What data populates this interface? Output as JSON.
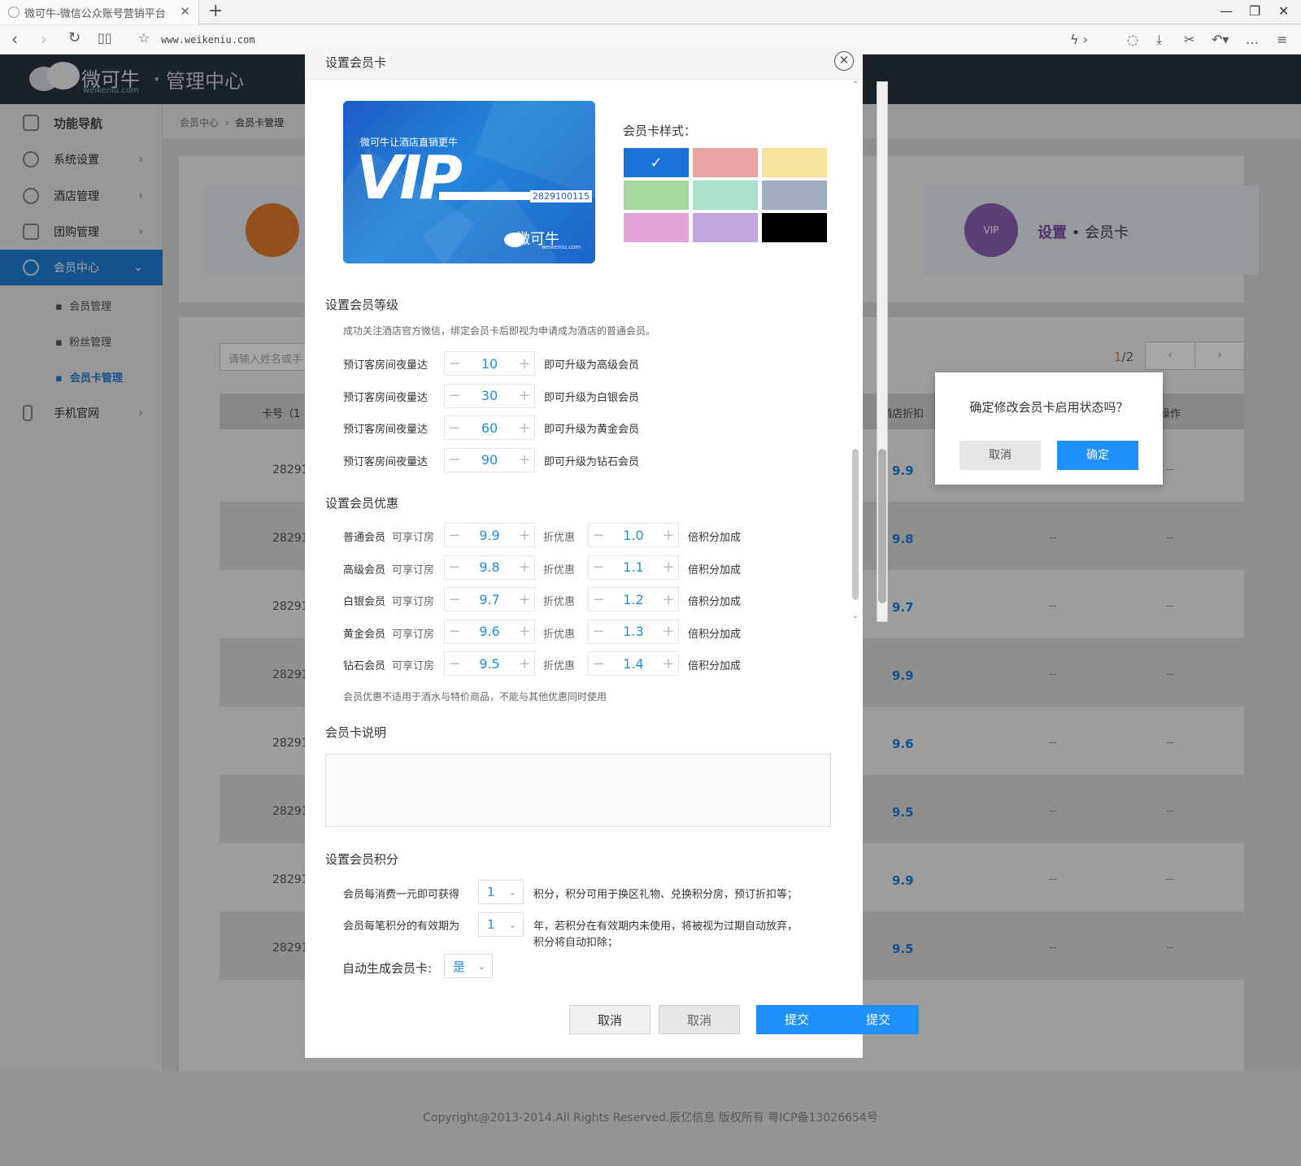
{
  "browser": {
    "tab_title": "微可牛-微信公众账号营销平台",
    "url": "www.weikeniu.com"
  },
  "header": {
    "logo_text": "微可牛",
    "logo_sub": "weikeniu.com",
    "title": "管理中心"
  },
  "sidebar": {
    "items": [
      {
        "label": "功能导航"
      },
      {
        "label": "系统设置"
      },
      {
        "label": "酒店管理"
      },
      {
        "label": "团购管理"
      },
      {
        "label": "会员中心"
      },
      {
        "label": "手机官网"
      }
    ],
    "sub_items": [
      {
        "label": "会员管理"
      },
      {
        "label": "粉丝管理"
      },
      {
        "label": "会员卡管理"
      }
    ]
  },
  "breadcrumb": {
    "parent": "会员中心",
    "current": "会员卡管理"
  },
  "feature": {
    "set_label": "设置",
    "card_label": "会员卡",
    "vip_badge": "VIP"
  },
  "list": {
    "search_placeholder": "请输入姓名或手",
    "page_current": "1",
    "page_total": "/2",
    "col_card": "卡号（1",
    "col_discount": "酒店折扣",
    "col_op": "操作",
    "rows": [
      {
        "id": "28291",
        "discount": "9.9",
        "d1": "--",
        "d2": "--"
      },
      {
        "id": "28291",
        "discount": "9.8",
        "d1": "--",
        "d2": "--"
      },
      {
        "id": "28291",
        "discount": "9.7",
        "d1": "--",
        "d2": "--"
      },
      {
        "id": "28291",
        "discount": "9.9",
        "d1": "--",
        "d2": "--"
      },
      {
        "id": "28291",
        "discount": "9.6",
        "d1": "--",
        "d2": "--"
      },
      {
        "id": "28291",
        "discount": "9.5",
        "d1": "--",
        "d2": "--"
      },
      {
        "id": "28291",
        "discount": "9.9",
        "d1": "--",
        "d2": "--"
      },
      {
        "id": "28291",
        "discount": "9.5",
        "d1": "--",
        "d2": "--"
      }
    ]
  },
  "footer": {
    "copyright": "Copyright@2013-2014.All Rights Reserved.辰亿信息 版权所有 粤ICP备13026654号"
  },
  "modal": {
    "title": "设置会员卡",
    "card": {
      "slogan": "微可牛让酒店直销更牛",
      "vip": "VIP",
      "number": "2829100115",
      "logo": "微可牛",
      "logo_sub": "weikeniu.com"
    },
    "style_label": "会员卡样式：",
    "swatches": [
      "#1a73d6",
      "#e8a3a3",
      "#f5e29b",
      "#a9d7a0",
      "#a6e3c8",
      "#a3abc3",
      "#e2a3d6",
      "#c3a6e0",
      "#000000"
    ],
    "level_title": "设置会员等级",
    "level_note": "成功关注酒店官方微信，绑定会员卡后即视为申请成为酒店的普通会员。",
    "levels": [
      {
        "label": "预订客房间夜量达",
        "value": "10",
        "suffix": "即可升级为高级会员"
      },
      {
        "label": "预订客房间夜量达",
        "value": "30",
        "suffix": "即可升级为白银会员"
      },
      {
        "label": "预订客房间夜量达",
        "value": "60",
        "suffix": "即可升级为黄金会员"
      },
      {
        "label": "预订客房间夜量达",
        "value": "90",
        "suffix": "即可升级为钻石会员"
      }
    ],
    "benefit_title": "设置会员优惠",
    "benefits": [
      {
        "name": "普通会员",
        "mid": "可享订房",
        "discount": "9.9",
        "unit": "折优惠",
        "points": "1.0",
        "suffix": "倍积分加成"
      },
      {
        "name": "高级会员",
        "mid": "可享订房",
        "discount": "9.8",
        "unit": "折优惠",
        "points": "1.1",
        "suffix": "倍积分加成"
      },
      {
        "name": "白银会员",
        "mid": "可享订房",
        "discount": "9.7",
        "unit": "折优惠",
        "points": "1.2",
        "suffix": "倍积分加成"
      },
      {
        "name": "黄金会员",
        "mid": "可享订房",
        "discount": "9.6",
        "unit": "折优惠",
        "points": "1.3",
        "suffix": "倍积分加成"
      },
      {
        "name": "钻石会员",
        "mid": "可享订房",
        "discount": "9.5",
        "unit": "折优惠",
        "points": "1.4",
        "suffix": "倍积分加成"
      }
    ],
    "benefit_note": "会员优惠不适用于酒水与特价商品，不能与其他优惠同时使用",
    "desc_title": "会员卡说明",
    "points_title": "设置会员积分",
    "points_row1": {
      "label": "会员每消费一元即可获得",
      "value": "1",
      "suffix": "积分，积分可用于换区礼物、兑换积分房，预订折扣等；"
    },
    "points_row2": {
      "label": "会员每笔积分的有效期为",
      "value": "1",
      "suffix1": "年，若积分在有效期内未使用，将被视为过期自动放弃，",
      "suffix2": "积分将自动扣除；"
    },
    "auto_label": "自动生成会员卡:",
    "auto_value": "是",
    "btn_cancel1": "取消",
    "btn_cancel2": "取消",
    "btn_submit1": "提交",
    "btn_submit2": "提交"
  },
  "confirm": {
    "message": "确定修改会员卡启用状态吗？",
    "cancel": "取消",
    "ok": "确定"
  }
}
